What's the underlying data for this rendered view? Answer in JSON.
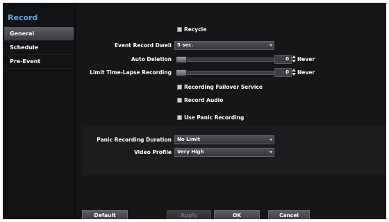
{
  "title": "Record",
  "sidebar": {
    "items": [
      {
        "label": "General",
        "active": true
      },
      {
        "label": "Schedule",
        "active": false
      },
      {
        "label": "Pre-Event",
        "active": false
      }
    ]
  },
  "settings": {
    "recycle": {
      "label": "Recycle",
      "checked": true
    },
    "event_record_dwell": {
      "label": "Event Record Dwell",
      "value": "5 sec."
    },
    "auto_deletion": {
      "label": "Auto Deletion",
      "value": "0",
      "unit": "Never",
      "level": 0
    },
    "limit_time_lapse": {
      "label": "Limit Time-Lapse Recording",
      "value": "0",
      "unit": "Never",
      "level": 0
    },
    "failover": {
      "label": "Recording Failover Service",
      "checked": true
    },
    "record_audio": {
      "label": "Record Audio",
      "checked": true
    },
    "use_panic": {
      "label": "Use Panic Recording",
      "checked": true
    }
  },
  "panic": {
    "duration": {
      "label": "Panic Recording Duration",
      "value": "No Limit"
    },
    "video_profile": {
      "label": "Video Profile",
      "value": "Very High"
    }
  },
  "footer": {
    "default": "Default",
    "apply": "Apply",
    "ok": "OK",
    "cancel": "Cancel"
  }
}
